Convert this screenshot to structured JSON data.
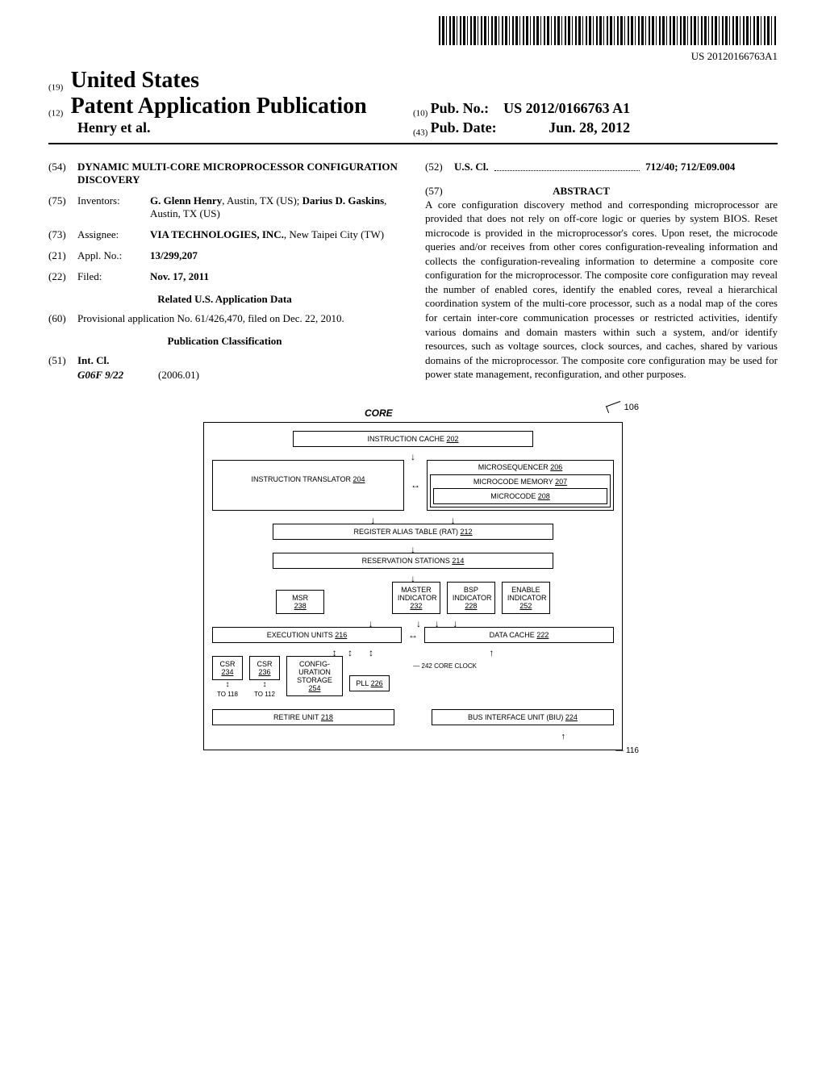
{
  "barcode_number": "US 20120166763A1",
  "header": {
    "code19": "(19)",
    "country": "United States",
    "code12": "(12)",
    "doc_type": "Patent Application Publication",
    "authors": "Henry et al.",
    "code10": "(10)",
    "pubno_label": "Pub. No.:",
    "pubno": "US 2012/0166763 A1",
    "code43": "(43)",
    "pubdate_label": "Pub. Date:",
    "pubdate": "Jun. 28, 2012"
  },
  "biblio": {
    "code54": "(54)",
    "title": "DYNAMIC MULTI-CORE MICROPROCESSOR CONFIGURATION DISCOVERY",
    "code75": "(75)",
    "inventors_label": "Inventors:",
    "inventors_val": "G. Glenn Henry, Austin, TX (US); Darius D. Gaskins, Austin, TX (US)",
    "code73": "(73)",
    "assignee_label": "Assignee:",
    "assignee_val": "VIA TECHNOLOGIES, INC., New Taipei City (TW)",
    "code21": "(21)",
    "applno_label": "Appl. No.:",
    "applno_val": "13/299,207",
    "code22": "(22)",
    "filed_label": "Filed:",
    "filed_val": "Nov. 17, 2011",
    "related_title": "Related U.S. Application Data",
    "code60": "(60)",
    "provisional": "Provisional application No. 61/426,470, filed on Dec. 22, 2010.",
    "pubclass_title": "Publication Classification",
    "code51": "(51)",
    "intcl_label": "Int. Cl.",
    "intcl_code": "G06F 9/22",
    "intcl_date": "(2006.01)",
    "code52": "(52)",
    "uscl_label": "U.S. Cl.",
    "uscl_val": "712/40; 712/E09.004",
    "code57": "(57)",
    "abstract_label": "ABSTRACT",
    "abstract_text": "A core configuration discovery method and corresponding microprocessor are provided that does not rely on off-core logic or queries by system BIOS. Reset microcode is provided in the microprocessor's cores. Upon reset, the microcode queries and/or receives from other cores configuration-revealing information and collects the configuration-revealing information to determine a composite core configuration for the microprocessor. The composite core configuration may reveal the number of enabled cores, identify the enabled cores, reveal a hierarchical coordination system of the multi-core processor, such as a nodal map of the cores for certain inter-core communication processes or restricted activities, identify various domains and domain masters within such a system, and/or identify resources, such as voltage sources, clock sources, and caches, shared by various domains of the microprocessor. The composite core configuration may be used for power state management, reconfiguration, and other purposes."
  },
  "diagram": {
    "title": "CORE",
    "ref106": "106",
    "instr_cache": "INSTRUCTION CACHE",
    "instr_cache_ref": "202",
    "instr_trans": "INSTRUCTION TRANSLATOR",
    "instr_trans_ref": "204",
    "microseq": "MICROSEQUENCER",
    "microseq_ref": "206",
    "microcode_mem": "MICROCODE MEMORY",
    "microcode_mem_ref": "207",
    "microcode": "MICROCODE",
    "microcode_ref": "208",
    "rat": "REGISTER ALIAS TABLE (RAT)",
    "rat_ref": "212",
    "res_stations": "RESERVATION STATIONS",
    "res_stations_ref": "214",
    "msr": "MSR",
    "msr_ref": "238",
    "master_ind": "MASTER INDICATOR",
    "master_ind_ref": "232",
    "bsp_ind": "BSP INDICATOR",
    "bsp_ind_ref": "228",
    "enable_ind": "ENABLE INDICATOR",
    "enable_ind_ref": "252",
    "exec_units": "EXECUTION UNITS",
    "exec_units_ref": "216",
    "data_cache": "DATA CACHE",
    "data_cache_ref": "222",
    "csr1": "CSR",
    "csr1_ref": "234",
    "csr2": "CSR",
    "csr2_ref": "236",
    "config_storage": "CONFIG-URATION STORAGE",
    "config_storage_ref": "254",
    "pll": "PLL",
    "pll_ref": "226",
    "core_clock": "242 CORE CLOCK",
    "to118": "TO 118",
    "to112": "TO 112",
    "retire": "RETIRE UNIT",
    "retire_ref": "218",
    "biu": "BUS INTERFACE UNIT (BIU)",
    "biu_ref": "224",
    "ref116": "116"
  }
}
